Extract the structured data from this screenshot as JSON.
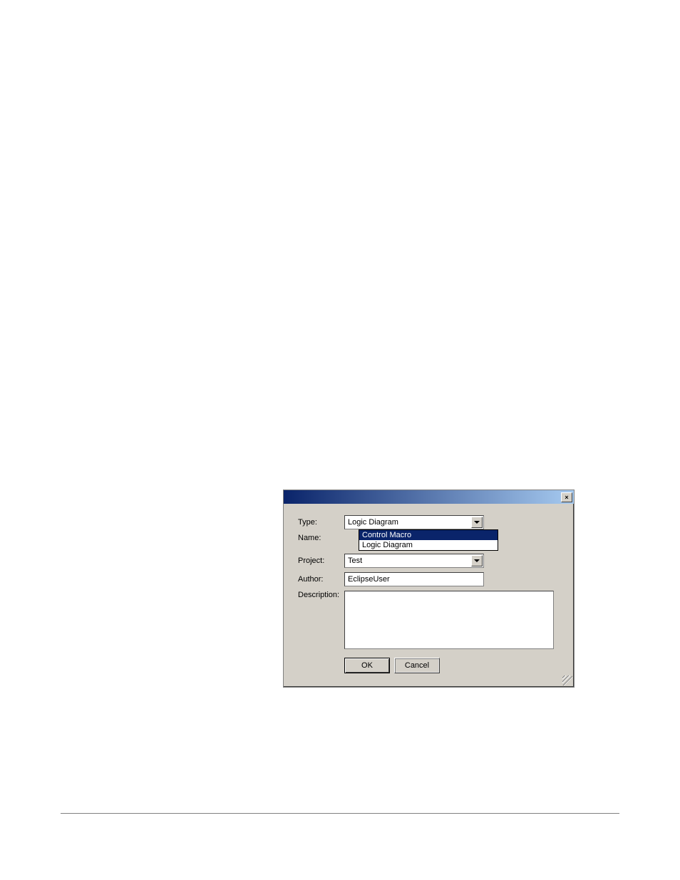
{
  "dialog": {
    "close_label": "×",
    "labels": {
      "type": "Type:",
      "name": "Name:",
      "project": "Project:",
      "author": "Author:",
      "description": "Description:"
    },
    "type_dropdown": {
      "selected": "Logic Diagram",
      "options": [
        "Control Macro",
        "Logic Diagram"
      ],
      "highlighted_index": 0
    },
    "name_value": "",
    "project_dropdown": {
      "selected": "Test"
    },
    "author_value": "EclipseUser",
    "description_value": "",
    "buttons": {
      "ok": "OK",
      "cancel": "Cancel"
    }
  }
}
